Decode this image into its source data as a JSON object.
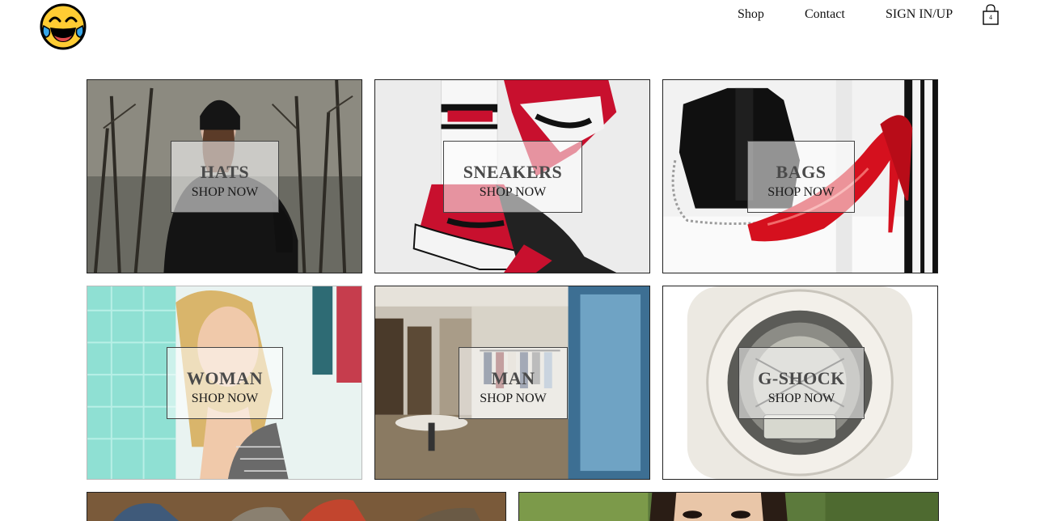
{
  "header": {
    "logo_icon": "laughing-emoji-icon",
    "nav": {
      "shop": "Shop",
      "contact": "Contact",
      "signin": "SIGN IN/UP"
    },
    "cart": {
      "icon": "shopping-bag-icon",
      "count": "4"
    }
  },
  "categories": [
    {
      "title": "HATS",
      "cta": "SHOP NOW"
    },
    {
      "title": "SNEAKERS",
      "cta": "SHOP NOW"
    },
    {
      "title": "BAGS",
      "cta": "SHOP NOW"
    },
    {
      "title": "WOMAN",
      "cta": "SHOP NOW"
    },
    {
      "title": "MAN",
      "cta": "SHOP NOW"
    },
    {
      "title": "G-SHOCK",
      "cta": "SHOP NOW"
    }
  ],
  "colors": {
    "overlay": "#ffffff",
    "accent_red": "#c8102e",
    "text_dark": "#4a4a4a"
  }
}
